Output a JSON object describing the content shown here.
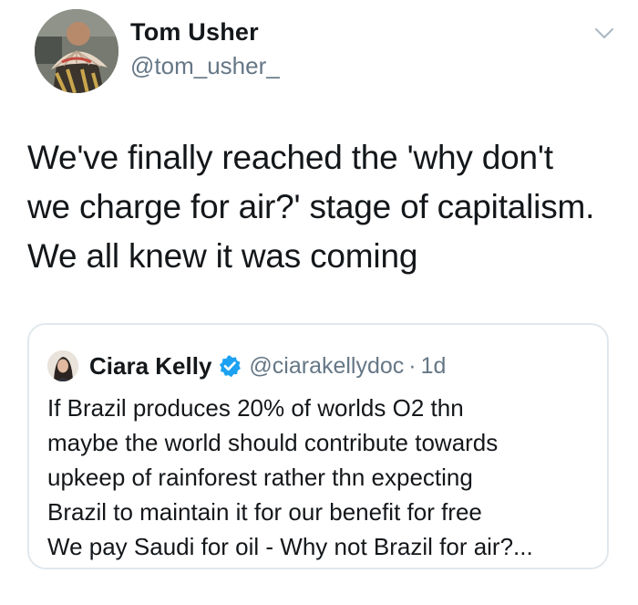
{
  "author": {
    "name": "Tom Usher",
    "handle": "@tom_usher_",
    "avatar_icon": "profile-photo"
  },
  "menu_icon": "chevron-down-icon",
  "tweet": {
    "lines": [
      "We've finally reached the 'why don't",
      "we charge for air?' stage of capitalism.",
      "We all knew it was coming"
    ]
  },
  "quoted_tweet": {
    "name": "Ciara Kelly",
    "verified": true,
    "verified_icon": "verified-badge-icon",
    "handle": "@ciarakellydoc",
    "separator": "·",
    "time": "1d",
    "lines": [
      "If Brazil produces 20% of worlds O2 thn",
      "maybe the world should contribute towards",
      "upkeep of rainforest rather thn expecting",
      "Brazil to maintain it for our benefit for free",
      "We pay Saudi for oil - Why not Brazil for air?..."
    ]
  },
  "colors": {
    "text_primary": "#14171a",
    "text_secondary": "#657786",
    "border": "#e1e8ed",
    "verified_blue": "#1da1f2"
  }
}
